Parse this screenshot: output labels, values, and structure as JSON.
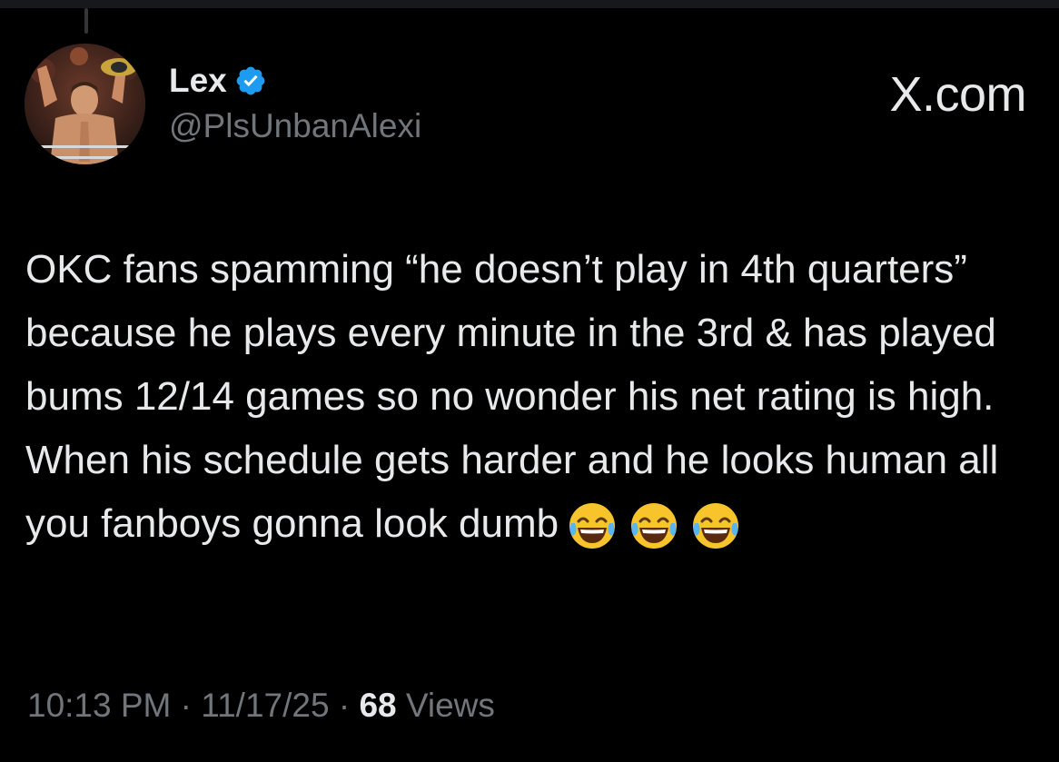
{
  "author": {
    "display_name": "Lex",
    "handle": "@PlsUnbanAlexi",
    "verified": true
  },
  "brand": "X.com",
  "tweet": {
    "text": "OKC fans spamming “he doesn’t play in 4th quarters” because he plays every minute in the 3rd & has played bums 12/14 games so no wonder his net rating is high. When his schedule gets harder and he looks human all you fanboys gonna look dumb",
    "emoji_count": 3,
    "emoji_name": "face-with-tears-of-joy"
  },
  "meta": {
    "time": "10:13 PM",
    "separator": " · ",
    "date": "11/17/25",
    "views_count": "68",
    "views_label": " Views"
  },
  "colors": {
    "background": "#000000",
    "text_primary": "#e7e9ea",
    "text_secondary": "#71767b",
    "verified_blue": "#1d9bf0"
  }
}
